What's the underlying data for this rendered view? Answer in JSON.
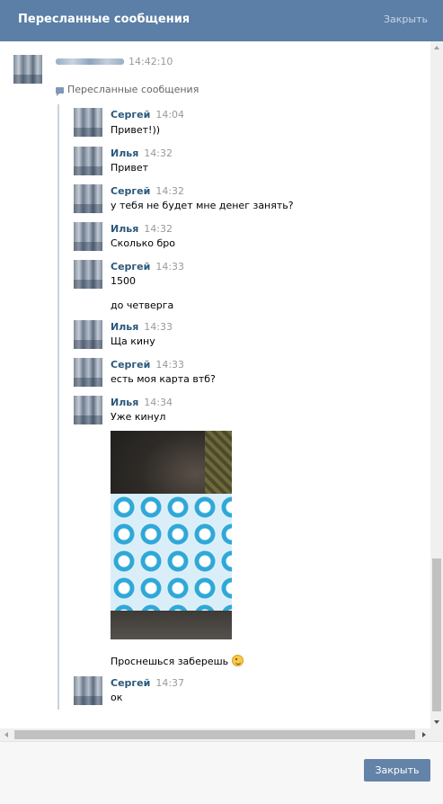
{
  "header": {
    "title": "Пересланные сообщения",
    "close_label": "Закрыть"
  },
  "message": {
    "time": "14:42:10",
    "forwarded_label": "Пересланные сообщения"
  },
  "forwarded": [
    {
      "name": "Сергей",
      "time": "14:04",
      "lines": [
        "Привет!))"
      ]
    },
    {
      "name": "Илья",
      "time": "14:32",
      "lines": [
        "Привет"
      ]
    },
    {
      "name": "Сергей",
      "time": "14:32",
      "lines": [
        "у тебя не будет мне денег занять?"
      ]
    },
    {
      "name": "Илья",
      "time": "14:32",
      "lines": [
        "Сколько бро"
      ]
    },
    {
      "name": "Сергей",
      "time": "14:33",
      "lines": [
        "1500",
        "до четверга"
      ]
    },
    {
      "name": "Илья",
      "time": "14:33",
      "lines": [
        "Ща кину"
      ]
    },
    {
      "name": "Сергей",
      "time": "14:33",
      "lines": [
        "есть моя карта втб?"
      ]
    },
    {
      "name": "Илья",
      "time": "14:34",
      "lines": [
        "Уже кинул",
        "Проснешься заберешь"
      ]
    },
    {
      "name": "Сергей",
      "time": "14:37",
      "lines": [
        "ок"
      ]
    }
  ],
  "icons": {
    "forward": "forward-icon",
    "emoji": "wink-emoji-icon"
  },
  "footer": {
    "close_button": "Закрыть"
  },
  "colors": {
    "header_bg": "#5b7fa6",
    "name": "#2b587a",
    "button": "#6383a8"
  }
}
